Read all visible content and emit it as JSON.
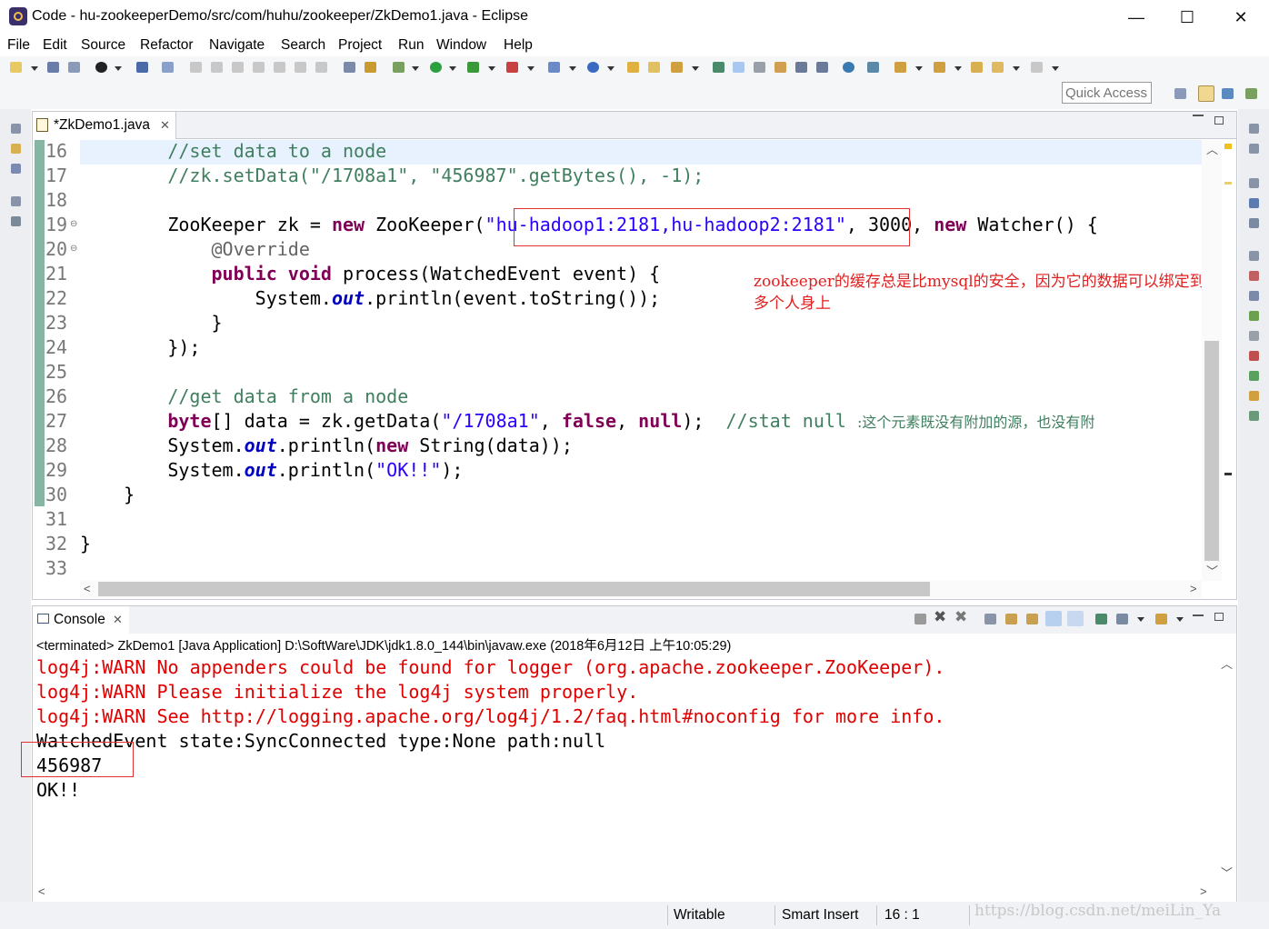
{
  "window": {
    "title": "Code - hu-zookeeperDemo/src/com/huhu/zookeeper/ZkDemo1.java - Eclipse",
    "minimize": "—",
    "maximize": "☐",
    "close": "✕"
  },
  "menu": [
    "File",
    "Edit",
    "Source",
    "Refactor",
    "Navigate",
    "Search",
    "Project",
    "Run",
    "Window",
    "Help"
  ],
  "quick_access": {
    "placeholder": "Quick Access"
  },
  "editor": {
    "tab_label": "*ZkDemo1.java",
    "line_numbers": [
      "16",
      "17",
      "18",
      "19",
      "20",
      "21",
      "22",
      "23",
      "24",
      "25",
      "26",
      "27",
      "28",
      "29",
      "30",
      "31",
      "32",
      "33"
    ],
    "lines": {
      "l16": "//set data to a node",
      "l17": "//zk.setData(\"/1708a1\", \"456987\".getBytes(), -1);",
      "l19_pre": "ZooKeeper zk = ",
      "l19_new1": "new",
      "l19_mid": " ZooKeeper(",
      "l19_str": "\"hu-hadoop1:2181,hu-hadoop2:2181\"",
      "l19_post": ", 3000, ",
      "l19_new2": "new",
      "l19_end": " Watcher() {",
      "l20": "@Override",
      "l21_kw1": "public",
      "l21_kw2": "void",
      "l21_rest": " process(WatchedEvent event) {",
      "l22_pre": "System.",
      "l22_fld": "out",
      "l22_post": ".println(event.toString());",
      "l23": "}",
      "l24": "});",
      "l26": "//get data from a node",
      "l27_kw1": "byte",
      "l27_a": "[] data = zk.getData(",
      "l27_str": "\"/1708a1\"",
      "l27_b": ", ",
      "l27_kw2": "false",
      "l27_c": ", ",
      "l27_kw3": "null",
      "l27_d": ");  ",
      "l27_cm": "//stat null ",
      "l27_cn": ":这个元素既没有附加的源，也没有附",
      "l28_pre": "System.",
      "l28_fld": "out",
      "l28_mid": ".println(",
      "l28_kw": "new",
      "l28_post": " String(data));",
      "l29_pre": "System.",
      "l29_fld": "out",
      "l29_mid": ".println(",
      "l29_str": "\"OK!!\"",
      "l29_post": ");",
      "l30": "}",
      "l32": "}"
    },
    "annotation_note": "zookeeper的缓存总是比mysql的安全，因为它的数据可以绑定到多个人身上"
  },
  "console": {
    "tab_label": "Console",
    "description": "<terminated> ZkDemo1 [Java Application] D:\\SoftWare\\JDK\\jdk1.8.0_144\\bin\\javaw.exe (2018年6月12日 上午10:05:29)",
    "warn_lines": [
      "log4j:WARN No appenders could be found for logger (org.apache.zookeeper.ZooKeeper).",
      "log4j:WARN Please initialize the log4j system properly.",
      "log4j:WARN See http://logging.apache.org/log4j/1.2/faq.html#noconfig for more info."
    ],
    "output_lines": [
      "WatchedEvent state:SyncConnected type:None path:null",
      "456987",
      "OK!!"
    ]
  },
  "status": {
    "writable": "Writable",
    "insert_mode": "Smart Insert",
    "position": "16 : 1"
  },
  "watermark": "https://blog.csdn.net/meiLin_Ya",
  "colors": {
    "keyword": "#7f0055",
    "string": "#2a00ff",
    "comment": "#3f7f5f",
    "warn": "#e00000",
    "highlight_box": "#e03030"
  }
}
